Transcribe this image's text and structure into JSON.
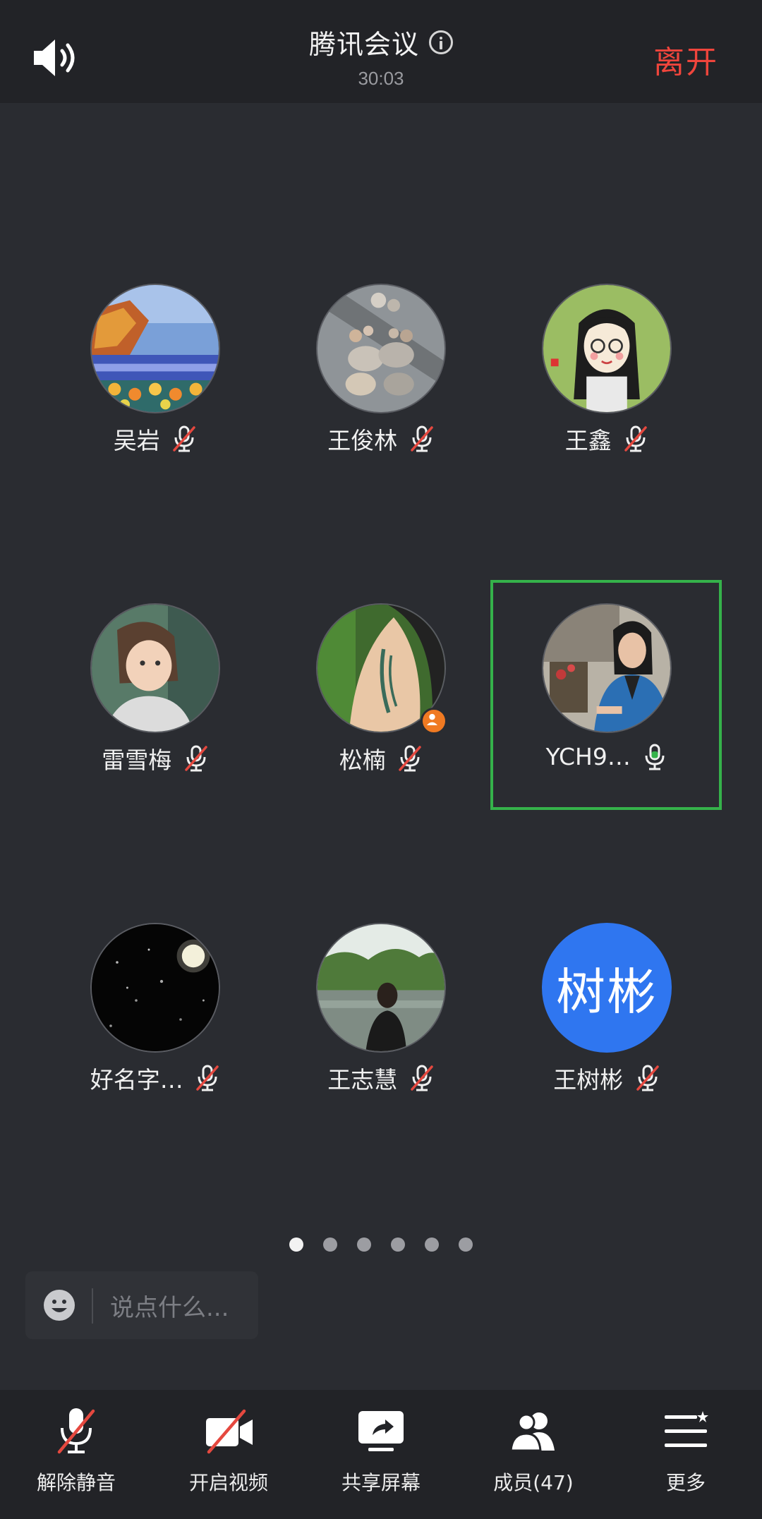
{
  "header": {
    "speaker_icon": "speaker-volume-icon",
    "title": "腾讯会议",
    "info_icon": "info-icon",
    "timer": "30:03",
    "leave": "离开"
  },
  "participants": [
    {
      "name": "吴岩",
      "mic": "muted"
    },
    {
      "name": "王俊林",
      "mic": "muted"
    },
    {
      "name": "王鑫",
      "mic": "muted"
    },
    {
      "name": "雷雪梅",
      "mic": "muted"
    },
    {
      "name": "松楠",
      "mic": "muted",
      "badge": "host-user-icon"
    },
    {
      "name": "YCH9…",
      "mic": "active",
      "speaking": true
    },
    {
      "name": "好名字…",
      "mic": "muted"
    },
    {
      "name": "王志慧",
      "mic": "muted"
    },
    {
      "name": "王树彬",
      "mic": "muted",
      "avatar_text": "树彬"
    }
  ],
  "pager": {
    "pages": 6,
    "current": 1
  },
  "chat": {
    "placeholder": "说点什么..."
  },
  "toolbar": {
    "unmute": "解除静音",
    "video": "开启视频",
    "share": "共享屏幕",
    "members": "成员(47)",
    "more": "更多"
  },
  "colors": {
    "background": "#2a2c31",
    "header": "#222327",
    "leave": "#f0453c",
    "muted_slash": "#e5483f",
    "speaking": "#35b24a",
    "text_avatar": "#2f76f0"
  }
}
